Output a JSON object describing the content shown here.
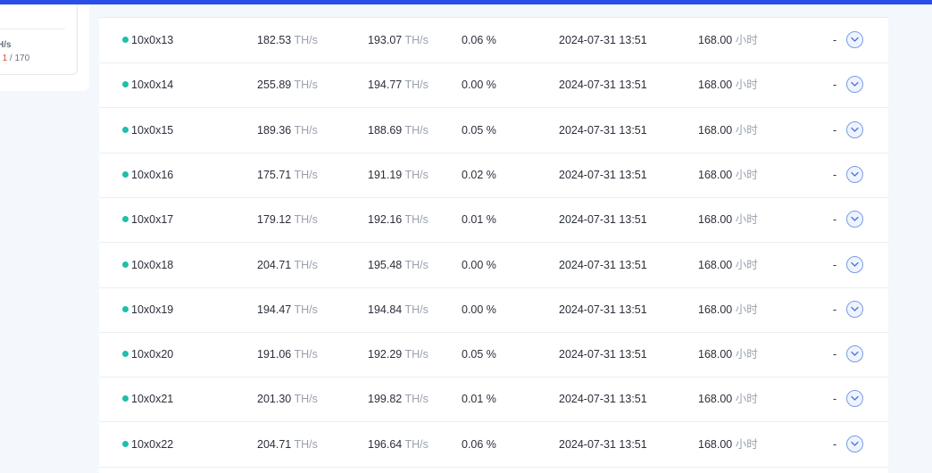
{
  "side": {
    "unit_label": "H/s",
    "count_sep1": "/",
    "count_mid": "1",
    "count_sep2": "/",
    "count_total": "170"
  },
  "units": {
    "hash": "TH/s",
    "hours": "小时"
  },
  "rows": [
    {
      "name": "10x0x13",
      "realtime": "182.53",
      "average": "193.07",
      "reject": "0.06 %",
      "last_seen": "2024-07-31 13:51",
      "duration": "168.00",
      "extra": "-"
    },
    {
      "name": "10x0x14",
      "realtime": "255.89",
      "average": "194.77",
      "reject": "0.00 %",
      "last_seen": "2024-07-31 13:51",
      "duration": "168.00",
      "extra": "-"
    },
    {
      "name": "10x0x15",
      "realtime": "189.36",
      "average": "188.69",
      "reject": "0.05 %",
      "last_seen": "2024-07-31 13:51",
      "duration": "168.00",
      "extra": "-"
    },
    {
      "name": "10x0x16",
      "realtime": "175.71",
      "average": "191.19",
      "reject": "0.02 %",
      "last_seen": "2024-07-31 13:51",
      "duration": "168.00",
      "extra": "-"
    },
    {
      "name": "10x0x17",
      "realtime": "179.12",
      "average": "192.16",
      "reject": "0.01 %",
      "last_seen": "2024-07-31 13:51",
      "duration": "168.00",
      "extra": "-"
    },
    {
      "name": "10x0x18",
      "realtime": "204.71",
      "average": "195.48",
      "reject": "0.00 %",
      "last_seen": "2024-07-31 13:51",
      "duration": "168.00",
      "extra": "-"
    },
    {
      "name": "10x0x19",
      "realtime": "194.47",
      "average": "194.84",
      "reject": "0.00 %",
      "last_seen": "2024-07-31 13:51",
      "duration": "168.00",
      "extra": "-"
    },
    {
      "name": "10x0x20",
      "realtime": "191.06",
      "average": "192.29",
      "reject": "0.05 %",
      "last_seen": "2024-07-31 13:51",
      "duration": "168.00",
      "extra": "-"
    },
    {
      "name": "10x0x21",
      "realtime": "201.30",
      "average": "199.82",
      "reject": "0.01 %",
      "last_seen": "2024-07-31 13:51",
      "duration": "168.00",
      "extra": "-"
    },
    {
      "name": "10x0x22",
      "realtime": "204.71",
      "average": "196.64",
      "reject": "0.06 %",
      "last_seen": "2024-07-31 13:51",
      "duration": "168.00",
      "extra": "-"
    }
  ],
  "colors": {
    "accent": "#2a4ee8",
    "status_online": "#1fbfa9",
    "expand_border": "#7a9ce6"
  },
  "icons": {
    "status": "online-dot-icon",
    "expand": "chevron-down-icon"
  }
}
